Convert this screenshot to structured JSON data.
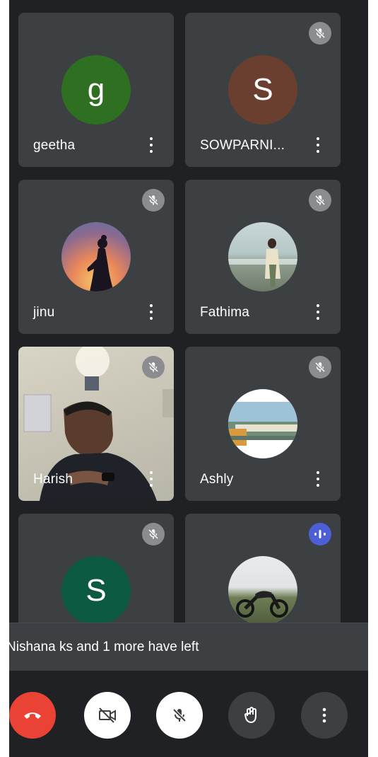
{
  "participants": [
    {
      "name": "geetha",
      "initial": "g",
      "avatar_color": "#2f6f22",
      "muted": false,
      "speaking": false
    },
    {
      "name": "SOWPARNI...",
      "initial": "S",
      "avatar_color": "#6a3f30",
      "muted": true,
      "speaking": false
    },
    {
      "name": "jinu",
      "muted": true,
      "photo": "sunset-silhouette"
    },
    {
      "name": "Fathima",
      "muted": true,
      "photo": "beach-portrait"
    },
    {
      "name": "Harish",
      "muted": true,
      "photo": "live-video"
    },
    {
      "name": "Ashly",
      "muted": true,
      "photo": "building-landscape"
    },
    {
      "initial": "S",
      "avatar_color": "#0d5a42",
      "muted": true
    },
    {
      "speaking": true,
      "photo": "motorcycle"
    }
  ],
  "toast": {
    "message": "Nishana ks and 1 more have left"
  },
  "controls": [
    {
      "id": "end-call",
      "icon": "phone-hangup-icon",
      "color": "#ea4335"
    },
    {
      "id": "camera",
      "icon": "camera-off-icon",
      "color": "#ffffff"
    },
    {
      "id": "microphone",
      "icon": "mic-off-icon",
      "color": "#ffffff"
    },
    {
      "id": "raise-hand",
      "icon": "hand-icon",
      "color": "#3c4043"
    },
    {
      "id": "more-options",
      "icon": "more-vertical-icon",
      "color": "#3c4043"
    }
  ]
}
